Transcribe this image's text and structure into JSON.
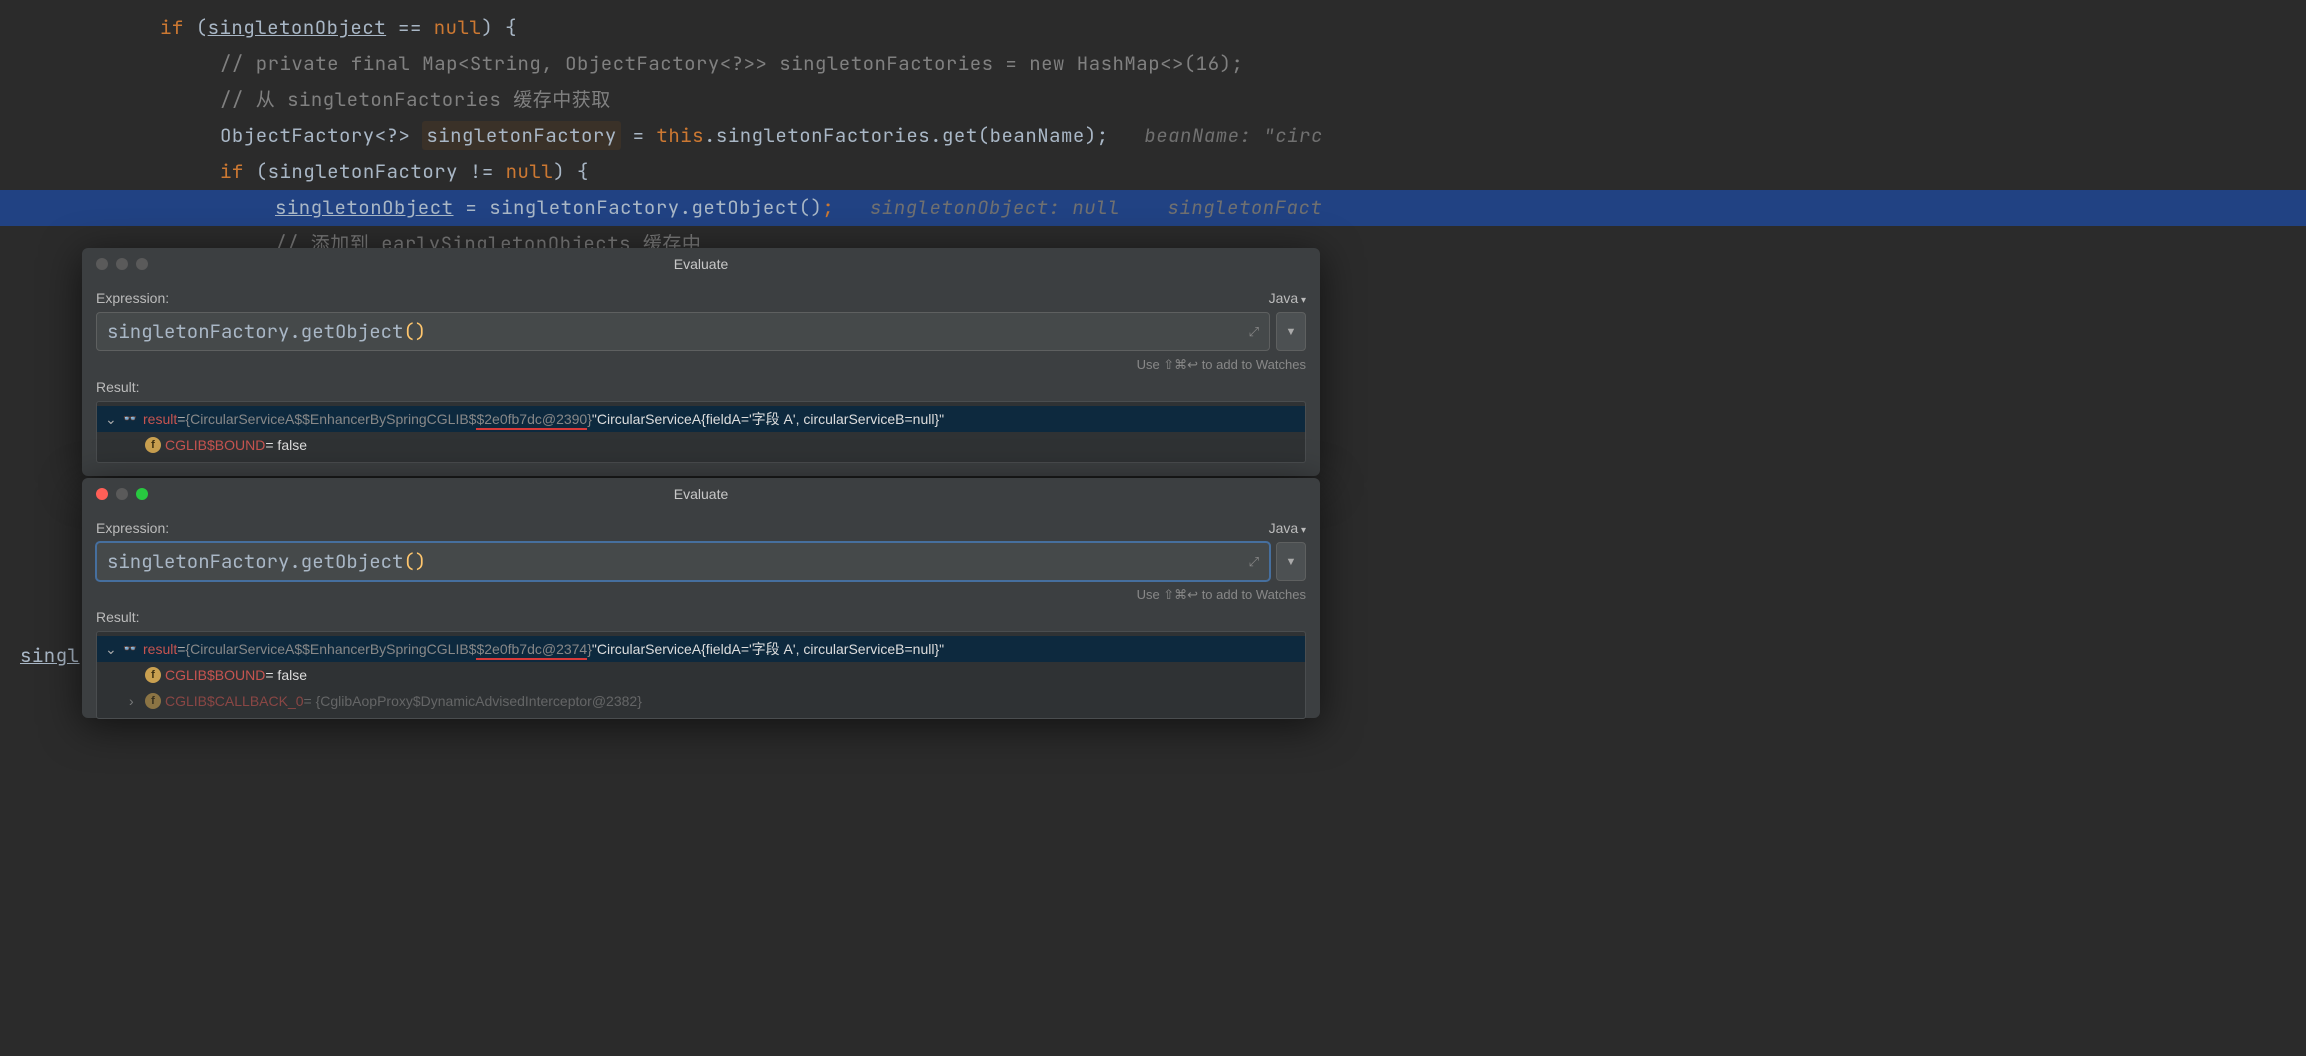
{
  "code": {
    "line1_if": "if",
    "line1_var": "singletonObject",
    "line1_eq": "==",
    "line1_null": "null",
    "line1_brace": ") {",
    "line2": "// private final Map<String, ObjectFactory<?>> singletonFactories = new HashMap<>(16);",
    "line3": "// 从 singletonFactories 缓存中获取",
    "line4_type": "ObjectFactory<?>",
    "line4_var": "singletonFactory",
    "line4_eq": " = ",
    "line4_this": "this",
    "line4_field": ".singletonFactories.get(beanName);",
    "line4_hint_label": "beanName:",
    "line4_hint_val": "\"circ",
    "line5_if": "if",
    "line5_open": " (singletonFactory != ",
    "line5_null": "null",
    "line5_close": ") {",
    "line6_var": "singletonObject",
    "line6_assign": " = ",
    "line6_call": "singletonFactory.getObject()",
    "line6_semi": ";",
    "line6_hint1": "singletonObject: null",
    "line6_hint2": "singletonFact",
    "line7_hidden": "// 添加到 earlySingletonObjects 缓存中",
    "bottom_brace": "}",
    "bottom_singl": "singl"
  },
  "dialog1": {
    "title": "Evaluate",
    "expr_label": "Expression:",
    "lang": "Java",
    "expr_text_pre": "singletonFactory.getObject",
    "expr_parens": "()",
    "hint": "Use ⇧⌘↩ to add to Watches",
    "result_label": "Result:",
    "result_name": "result",
    "eq": " = ",
    "result_type_pre": "{CircularServiceA$$EnhancerBySpringCGLIB$",
    "result_type_under": "$2e0fb7dc@2390",
    "result_type_post": "}",
    "result_str": " \"CircularServiceA{fieldA='字段 A', circularServiceB=null}\"",
    "child1_name": "CGLIB$BOUND",
    "child1_val": " = false"
  },
  "dialog2": {
    "title": "Evaluate",
    "expr_label": "Expression:",
    "lang": "Java",
    "expr_text_pre": "singletonFactory.getObject",
    "expr_parens": "()",
    "hint": "Use ⇧⌘↩ to add to Watches",
    "result_label": "Result:",
    "result_name": "result",
    "eq": " = ",
    "result_type_pre": "{CircularServiceA$$EnhancerBySpringCGLIB$",
    "result_type_under": "$2e0fb7dc@2374",
    "result_type_post": "}",
    "result_str": " \"CircularServiceA{fieldA='字段 A', circularServiceB=null}\"",
    "child1_name": "CGLIB$BOUND",
    "child1_val": " = false",
    "child2_name": "CGLIB$CALLBACK_0",
    "child2_val_pre": " = {CglibAopProxy$DynamicAdvisedInterceptor@2382}"
  }
}
